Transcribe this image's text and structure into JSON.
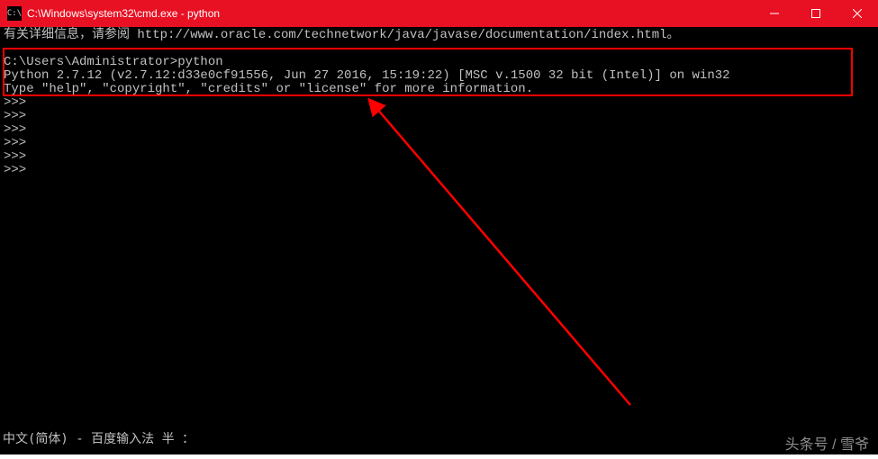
{
  "titlebar": {
    "icon_label": "C:\\",
    "title": "C:\\Windows\\system32\\cmd.exe - python"
  },
  "terminal": {
    "line_info": "有关详细信息，请参阅 http://www.oracle.com/technetwork/java/javase/documentation/index.html。",
    "blank1": "",
    "prompt_line": "C:\\Users\\Administrator>python",
    "python_banner1": "Python 2.7.12 (v2.7.12:d33e0cf91556, Jun 27 2016, 15:19:22) [MSC v.1500 32 bit (Intel)] on win32",
    "python_banner2": "Type \"help\", \"copyright\", \"credits\" or \"license\" for more information.",
    "repl1": ">>>",
    "repl2": ">>>",
    "repl3": ">>>",
    "repl4": ">>>",
    "repl5": ">>>",
    "repl6": ">>>"
  },
  "statusbar": {
    "text": "中文(简体) - 百度输入法 半 ："
  },
  "watermark": {
    "text": "头条号 / 雪爷"
  },
  "colors": {
    "titlebar_bg": "#e81123",
    "terminal_bg": "#000000",
    "terminal_fg": "#c0c0c0",
    "highlight": "#ff0000"
  }
}
